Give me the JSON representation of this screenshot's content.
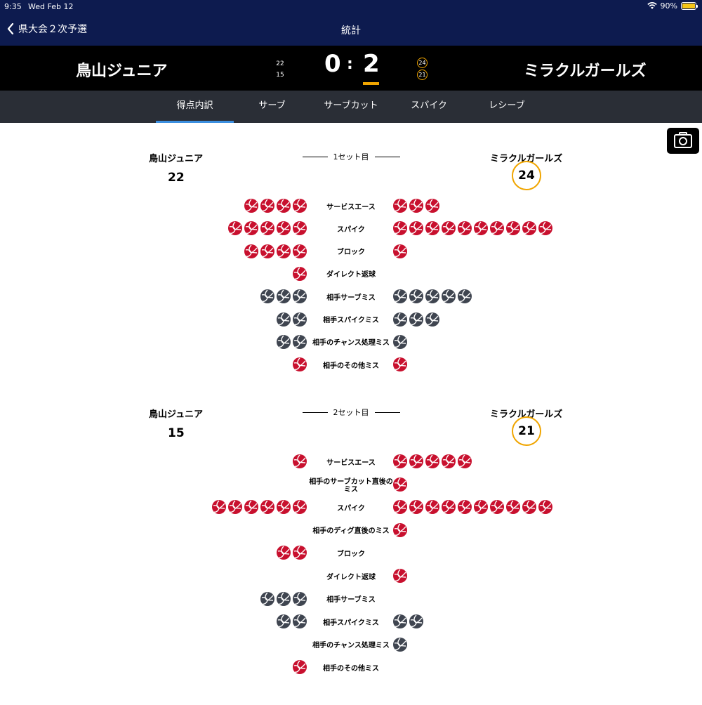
{
  "status_bar": {
    "time": "9:35",
    "date": "Wed Feb 12",
    "battery": "90%"
  },
  "nav": {
    "back_label": "県大会２次予選",
    "title": "統計"
  },
  "score": {
    "home_team": "鳥山ジュニア",
    "away_team": "ミラクルガールズ",
    "home_sets": "0",
    "away_sets": "2",
    "colon": ":",
    "home_set_scores": [
      "22",
      "15"
    ],
    "away_set_scores": [
      "24",
      "21"
    ]
  },
  "tabs": [
    {
      "label": "得点内訳",
      "active": true
    },
    {
      "label": "サーブ",
      "active": false
    },
    {
      "label": "サーブカット",
      "active": false
    },
    {
      "label": "スパイク",
      "active": false
    },
    {
      "label": "レシーブ",
      "active": false
    }
  ],
  "colors": {
    "accent": "#f0a500",
    "tab_indicator": "#3b8fe0",
    "own_point": "#c8102e",
    "opponent_error": "#3f4550",
    "nav_bg": "#0d1b4f"
  },
  "sets": [
    {
      "title": "1セット目",
      "home_team": "鳥山ジュニア",
      "away_team": "ミラクルガールズ",
      "home_points": "22",
      "away_points": "24",
      "rows": [
        {
          "label": "サービスエース",
          "home": 4,
          "away": 3,
          "color": "red"
        },
        {
          "label": "スパイク",
          "home": 5,
          "away": 10,
          "color": "red"
        },
        {
          "label": "ブロック",
          "home": 4,
          "away": 1,
          "color": "red"
        },
        {
          "label": "ダイレクト返球",
          "home": 1,
          "away": 0,
          "color": "red"
        },
        {
          "label": "相手サーブミス",
          "home": 3,
          "away": 5,
          "color": "gray"
        },
        {
          "label": "相手スパイクミス",
          "home": 2,
          "away": 3,
          "color": "gray"
        },
        {
          "label": "相手のチャンス処理ミス",
          "home": 2,
          "away": 1,
          "color": "gray"
        },
        {
          "label": "相手のその他ミス",
          "home": 1,
          "away": 1,
          "color": "red"
        }
      ]
    },
    {
      "title": "2セット目",
      "home_team": "鳥山ジュニア",
      "away_team": "ミラクルガールズ",
      "home_points": "15",
      "away_points": "21",
      "rows": [
        {
          "label": "サービスエース",
          "home": 1,
          "away": 5,
          "color": "red"
        },
        {
          "label": "相手のサーブカット直後のミス",
          "home": 0,
          "away": 1,
          "color": "red"
        },
        {
          "label": "スパイク",
          "home": 6,
          "away": 10,
          "color": "red"
        },
        {
          "label": "相手のディグ直後のミス",
          "home": 0,
          "away": 1,
          "color": "red"
        },
        {
          "label": "ブロック",
          "home": 2,
          "away": 0,
          "color": "red"
        },
        {
          "label": "ダイレクト返球",
          "home": 0,
          "away": 1,
          "color": "red"
        },
        {
          "label": "相手サーブミス",
          "home": 3,
          "away": 0,
          "color": "gray"
        },
        {
          "label": "相手スパイクミス",
          "home": 2,
          "away": 2,
          "color": "gray"
        },
        {
          "label": "相手のチャンス処理ミス",
          "home": 0,
          "away": 1,
          "color": "gray"
        },
        {
          "label": "相手のその他ミス",
          "home": 1,
          "away": 0,
          "color": "red"
        }
      ]
    }
  ]
}
